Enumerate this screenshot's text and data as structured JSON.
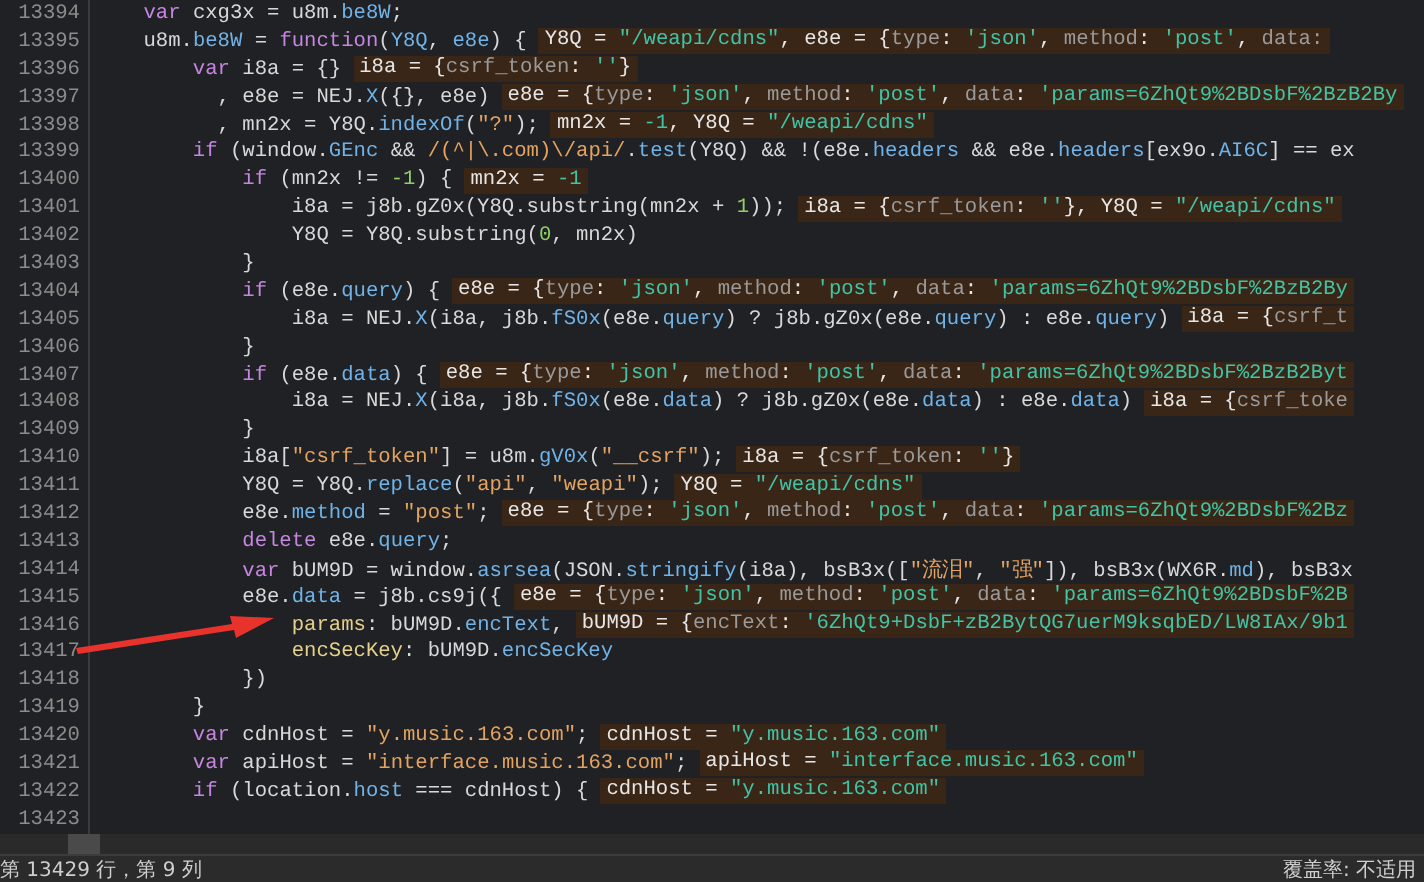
{
  "editor": {
    "lines": [
      {
        "number": "13394",
        "code": [
          {
            "kind": "keyword",
            "text": "    var"
          },
          {
            "kind": "plain",
            "text": " cxg3x = u8m."
          },
          {
            "kind": "property",
            "text": "be8W"
          },
          {
            "kind": "plain",
            "text": ";"
          }
        ]
      },
      {
        "number": "13395",
        "code": [
          {
            "kind": "plain",
            "text": "    u8m."
          },
          {
            "kind": "property",
            "text": "be8W"
          },
          {
            "kind": "plain",
            "text": " = "
          },
          {
            "kind": "keyword",
            "text": "function"
          },
          {
            "kind": "plain",
            "text": "("
          },
          {
            "kind": "property",
            "text": "Y8Q"
          },
          {
            "kind": "plain",
            "text": ", "
          },
          {
            "kind": "property",
            "text": "e8e"
          },
          {
            "kind": "plain",
            "text": ") {"
          }
        ],
        "values": [
          {
            "kind": "plain",
            "text": "Y8Q = "
          },
          {
            "kind": "str",
            "text": "\"/weapi/cdns\""
          },
          {
            "kind": "plain",
            "text": ", e8e = {"
          },
          {
            "kind": "key",
            "text": "type"
          },
          {
            "kind": "plain",
            "text": ": "
          },
          {
            "kind": "str",
            "text": "'json'"
          },
          {
            "kind": "plain",
            "text": ", "
          },
          {
            "kind": "key",
            "text": "method"
          },
          {
            "kind": "plain",
            "text": ": "
          },
          {
            "kind": "str",
            "text": "'post'"
          },
          {
            "kind": "plain",
            "text": ", "
          },
          {
            "kind": "key",
            "text": "data:"
          }
        ]
      },
      {
        "number": "13396",
        "code": [
          {
            "kind": "keyword",
            "text": "        var"
          },
          {
            "kind": "plain",
            "text": " i8a = {}"
          }
        ],
        "values": [
          {
            "kind": "plain",
            "text": "i8a = {"
          },
          {
            "kind": "key",
            "text": "csrf_token"
          },
          {
            "kind": "plain",
            "text": ": "
          },
          {
            "kind": "str",
            "text": "''"
          },
          {
            "kind": "plain",
            "text": "}"
          }
        ]
      },
      {
        "number": "13397",
        "code": [
          {
            "kind": "plain",
            "text": "          , e8e = NEJ."
          },
          {
            "kind": "property",
            "text": "X"
          },
          {
            "kind": "plain",
            "text": "({}, e8e)"
          }
        ],
        "values": [
          {
            "kind": "plain",
            "text": "e8e = {"
          },
          {
            "kind": "key",
            "text": "type"
          },
          {
            "kind": "plain",
            "text": ": "
          },
          {
            "kind": "str",
            "text": "'json'"
          },
          {
            "kind": "plain",
            "text": ", "
          },
          {
            "kind": "key",
            "text": "method"
          },
          {
            "kind": "plain",
            "text": ": "
          },
          {
            "kind": "str",
            "text": "'post'"
          },
          {
            "kind": "plain",
            "text": ", "
          },
          {
            "kind": "key",
            "text": "data"
          },
          {
            "kind": "plain",
            "text": ": "
          },
          {
            "kind": "str",
            "text": "'params=6ZhQt9%2BDsbF%2BzB2By"
          }
        ]
      },
      {
        "number": "13398",
        "code": [
          {
            "kind": "plain",
            "text": "          , mn2x = Y8Q."
          },
          {
            "kind": "property",
            "text": "indexOf"
          },
          {
            "kind": "plain",
            "text": "("
          },
          {
            "kind": "string",
            "text": "\"?\""
          },
          {
            "kind": "plain",
            "text": ");"
          }
        ],
        "values": [
          {
            "kind": "plain",
            "text": "mn2x = "
          },
          {
            "kind": "str",
            "text": "-1"
          },
          {
            "kind": "plain",
            "text": ", Y8Q = "
          },
          {
            "kind": "str",
            "text": "\"/weapi/cdns\""
          }
        ]
      },
      {
        "number": "13399",
        "code": [
          {
            "kind": "keyword",
            "text": "        if"
          },
          {
            "kind": "plain",
            "text": " (window."
          },
          {
            "kind": "property",
            "text": "GEnc"
          },
          {
            "kind": "plain",
            "text": " && "
          },
          {
            "kind": "string",
            "text": "/(^|\\.com)\\/api/"
          },
          {
            "kind": "plain",
            "text": "."
          },
          {
            "kind": "property",
            "text": "test"
          },
          {
            "kind": "plain",
            "text": "(Y8Q) && !(e8e."
          },
          {
            "kind": "property",
            "text": "headers"
          },
          {
            "kind": "plain",
            "text": " && e8e."
          },
          {
            "kind": "property",
            "text": "headers"
          },
          {
            "kind": "plain",
            "text": "[ex9o."
          },
          {
            "kind": "property",
            "text": "AI6C"
          },
          {
            "kind": "plain",
            "text": "] == ex"
          }
        ]
      },
      {
        "number": "13400",
        "code": [
          {
            "kind": "keyword",
            "text": "            if"
          },
          {
            "kind": "plain",
            "text": " (mn2x != "
          },
          {
            "kind": "number",
            "text": "-1"
          },
          {
            "kind": "plain",
            "text": ") {"
          }
        ],
        "values": [
          {
            "kind": "plain",
            "text": "mn2x = "
          },
          {
            "kind": "str",
            "text": "-1"
          }
        ]
      },
      {
        "number": "13401",
        "code": [
          {
            "kind": "plain",
            "text": "                i8a = j8b.gZ0x(Y8Q.substring(mn2x + "
          },
          {
            "kind": "number",
            "text": "1"
          },
          {
            "kind": "plain",
            "text": "));"
          }
        ],
        "values": [
          {
            "kind": "plain",
            "text": "i8a = {"
          },
          {
            "kind": "key",
            "text": "csrf_token"
          },
          {
            "kind": "plain",
            "text": ": "
          },
          {
            "kind": "str",
            "text": "''"
          },
          {
            "kind": "plain",
            "text": "}, Y8Q = "
          },
          {
            "kind": "str",
            "text": "\"/weapi/cdns\""
          }
        ]
      },
      {
        "number": "13402",
        "code": [
          {
            "kind": "plain",
            "text": "                Y8Q = Y8Q.substring("
          },
          {
            "kind": "number",
            "text": "0"
          },
          {
            "kind": "plain",
            "text": ", mn2x)"
          }
        ]
      },
      {
        "number": "13403",
        "code": [
          {
            "kind": "plain",
            "text": "            }"
          }
        ]
      },
      {
        "number": "13404",
        "code": [
          {
            "kind": "keyword",
            "text": "            if"
          },
          {
            "kind": "plain",
            "text": " (e8e."
          },
          {
            "kind": "property",
            "text": "query"
          },
          {
            "kind": "plain",
            "text": ") {"
          }
        ],
        "values": [
          {
            "kind": "plain",
            "text": "e8e = {"
          },
          {
            "kind": "key",
            "text": "type"
          },
          {
            "kind": "plain",
            "text": ": "
          },
          {
            "kind": "str",
            "text": "'json'"
          },
          {
            "kind": "plain",
            "text": ", "
          },
          {
            "kind": "key",
            "text": "method"
          },
          {
            "kind": "plain",
            "text": ": "
          },
          {
            "kind": "str",
            "text": "'post'"
          },
          {
            "kind": "plain",
            "text": ", "
          },
          {
            "kind": "key",
            "text": "data"
          },
          {
            "kind": "plain",
            "text": ": "
          },
          {
            "kind": "str",
            "text": "'params=6ZhQt9%2BDsbF%2BzB2By"
          }
        ]
      },
      {
        "number": "13405",
        "code": [
          {
            "kind": "plain",
            "text": "                i8a = NEJ."
          },
          {
            "kind": "property",
            "text": "X"
          },
          {
            "kind": "plain",
            "text": "(i8a, j8b."
          },
          {
            "kind": "property",
            "text": "fS0x"
          },
          {
            "kind": "plain",
            "text": "(e8e."
          },
          {
            "kind": "property",
            "text": "query"
          },
          {
            "kind": "plain",
            "text": ") ? j8b.gZ0x(e8e."
          },
          {
            "kind": "property",
            "text": "query"
          },
          {
            "kind": "plain",
            "text": ") : e8e."
          },
          {
            "kind": "property",
            "text": "query"
          },
          {
            "kind": "plain",
            "text": ")"
          }
        ],
        "values": [
          {
            "kind": "plain",
            "text": "i8a = {"
          },
          {
            "kind": "key",
            "text": "csrf_t"
          }
        ]
      },
      {
        "number": "13406",
        "code": [
          {
            "kind": "plain",
            "text": "            }"
          }
        ]
      },
      {
        "number": "13407",
        "code": [
          {
            "kind": "keyword",
            "text": "            if"
          },
          {
            "kind": "plain",
            "text": " (e8e."
          },
          {
            "kind": "property",
            "text": "data"
          },
          {
            "kind": "plain",
            "text": ") {"
          }
        ],
        "values": [
          {
            "kind": "plain",
            "text": "e8e = {"
          },
          {
            "kind": "key",
            "text": "type"
          },
          {
            "kind": "plain",
            "text": ": "
          },
          {
            "kind": "str",
            "text": "'json'"
          },
          {
            "kind": "plain",
            "text": ", "
          },
          {
            "kind": "key",
            "text": "method"
          },
          {
            "kind": "plain",
            "text": ": "
          },
          {
            "kind": "str",
            "text": "'post'"
          },
          {
            "kind": "plain",
            "text": ", "
          },
          {
            "kind": "key",
            "text": "data"
          },
          {
            "kind": "plain",
            "text": ": "
          },
          {
            "kind": "str",
            "text": "'params=6ZhQt9%2BDsbF%2BzB2Byt"
          }
        ]
      },
      {
        "number": "13408",
        "code": [
          {
            "kind": "plain",
            "text": "                i8a = NEJ."
          },
          {
            "kind": "property",
            "text": "X"
          },
          {
            "kind": "plain",
            "text": "(i8a, j8b."
          },
          {
            "kind": "property",
            "text": "fS0x"
          },
          {
            "kind": "plain",
            "text": "(e8e."
          },
          {
            "kind": "property",
            "text": "data"
          },
          {
            "kind": "plain",
            "text": ") ? j8b.gZ0x(e8e."
          },
          {
            "kind": "property",
            "text": "data"
          },
          {
            "kind": "plain",
            "text": ") : e8e."
          },
          {
            "kind": "property",
            "text": "data"
          },
          {
            "kind": "plain",
            "text": ")"
          }
        ],
        "values": [
          {
            "kind": "plain",
            "text": "i8a = {"
          },
          {
            "kind": "key",
            "text": "csrf_toke"
          }
        ]
      },
      {
        "number": "13409",
        "code": [
          {
            "kind": "plain",
            "text": "            }"
          }
        ]
      },
      {
        "number": "13410",
        "code": [
          {
            "kind": "plain",
            "text": "            i8a["
          },
          {
            "kind": "string",
            "text": "\"csrf_token\""
          },
          {
            "kind": "plain",
            "text": "] = u8m."
          },
          {
            "kind": "property",
            "text": "gV0x"
          },
          {
            "kind": "plain",
            "text": "("
          },
          {
            "kind": "string",
            "text": "\"__csrf\""
          },
          {
            "kind": "plain",
            "text": ");"
          }
        ],
        "values": [
          {
            "kind": "plain",
            "text": "i8a = {"
          },
          {
            "kind": "key",
            "text": "csrf_token"
          },
          {
            "kind": "plain",
            "text": ": "
          },
          {
            "kind": "str",
            "text": "''"
          },
          {
            "kind": "plain",
            "text": "}"
          }
        ]
      },
      {
        "number": "13411",
        "code": [
          {
            "kind": "plain",
            "text": "            Y8Q = Y8Q."
          },
          {
            "kind": "property",
            "text": "replace"
          },
          {
            "kind": "plain",
            "text": "("
          },
          {
            "kind": "string",
            "text": "\"api\""
          },
          {
            "kind": "plain",
            "text": ", "
          },
          {
            "kind": "string",
            "text": "\"weapi\""
          },
          {
            "kind": "plain",
            "text": ");"
          }
        ],
        "values": [
          {
            "kind": "plain",
            "text": "Y8Q = "
          },
          {
            "kind": "str",
            "text": "\"/weapi/cdns\""
          }
        ]
      },
      {
        "number": "13412",
        "code": [
          {
            "kind": "plain",
            "text": "            e8e."
          },
          {
            "kind": "property",
            "text": "method"
          },
          {
            "kind": "plain",
            "text": " = "
          },
          {
            "kind": "string",
            "text": "\"post\""
          },
          {
            "kind": "plain",
            "text": ";"
          }
        ],
        "values": [
          {
            "kind": "plain",
            "text": "e8e = {"
          },
          {
            "kind": "key",
            "text": "type"
          },
          {
            "kind": "plain",
            "text": ": "
          },
          {
            "kind": "str",
            "text": "'json'"
          },
          {
            "kind": "plain",
            "text": ", "
          },
          {
            "kind": "key",
            "text": "method"
          },
          {
            "kind": "plain",
            "text": ": "
          },
          {
            "kind": "str",
            "text": "'post'"
          },
          {
            "kind": "plain",
            "text": ", "
          },
          {
            "kind": "key",
            "text": "data"
          },
          {
            "kind": "plain",
            "text": ": "
          },
          {
            "kind": "str",
            "text": "'params=6ZhQt9%2BDsbF%2Bz"
          }
        ]
      },
      {
        "number": "13413",
        "code": [
          {
            "kind": "keyword",
            "text": "            delete"
          },
          {
            "kind": "plain",
            "text": " e8e."
          },
          {
            "kind": "property",
            "text": "query"
          },
          {
            "kind": "plain",
            "text": ";"
          }
        ]
      },
      {
        "number": "13414",
        "code": [
          {
            "kind": "keyword",
            "text": "            var"
          },
          {
            "kind": "plain",
            "text": " bUM9D = window."
          },
          {
            "kind": "property",
            "text": "asrsea"
          },
          {
            "kind": "plain",
            "text": "(JSON."
          },
          {
            "kind": "property",
            "text": "stringify"
          },
          {
            "kind": "plain",
            "text": "(i8a), bsB3x(["
          },
          {
            "kind": "string",
            "text": "\"流泪\""
          },
          {
            "kind": "plain",
            "text": ", "
          },
          {
            "kind": "string",
            "text": "\"强\""
          },
          {
            "kind": "plain",
            "text": "]), bsB3x(WX6R."
          },
          {
            "kind": "property",
            "text": "md"
          },
          {
            "kind": "plain",
            "text": "), bsB3x"
          }
        ]
      },
      {
        "number": "13415",
        "code": [
          {
            "kind": "plain",
            "text": "            e8e."
          },
          {
            "kind": "property",
            "text": "data"
          },
          {
            "kind": "plain",
            "text": " = j8b.cs9j({"
          }
        ],
        "values": [
          {
            "kind": "plain",
            "text": "e8e = {"
          },
          {
            "kind": "key",
            "text": "type"
          },
          {
            "kind": "plain",
            "text": ": "
          },
          {
            "kind": "str",
            "text": "'json'"
          },
          {
            "kind": "plain",
            "text": ", "
          },
          {
            "kind": "key",
            "text": "method"
          },
          {
            "kind": "plain",
            "text": ": "
          },
          {
            "kind": "str",
            "text": "'post'"
          },
          {
            "kind": "plain",
            "text": ", "
          },
          {
            "kind": "key",
            "text": "data"
          },
          {
            "kind": "plain",
            "text": ": "
          },
          {
            "kind": "str",
            "text": "'params=6ZhQt9%2BDsbF%2B"
          }
        ]
      },
      {
        "number": "13416",
        "code": [
          {
            "kind": "label",
            "text": "                params"
          },
          {
            "kind": "plain",
            "text": ": bUM9D."
          },
          {
            "kind": "property",
            "text": "encText"
          },
          {
            "kind": "plain",
            "text": ","
          }
        ],
        "values": [
          {
            "kind": "plain",
            "text": "bUM9D = {"
          },
          {
            "kind": "key",
            "text": "encText"
          },
          {
            "kind": "plain",
            "text": ": "
          },
          {
            "kind": "str",
            "text": "'6ZhQt9+DsbF+zB2BytQG7uerM9ksqbED/LW8IAx/9b1"
          }
        ]
      },
      {
        "number": "13417",
        "code": [
          {
            "kind": "label",
            "text": "                encSecKey"
          },
          {
            "kind": "plain",
            "text": ": bUM9D."
          },
          {
            "kind": "property",
            "text": "encSecKey"
          }
        ]
      },
      {
        "number": "13418",
        "code": [
          {
            "kind": "plain",
            "text": "            })"
          }
        ]
      },
      {
        "number": "13419",
        "code": [
          {
            "kind": "plain",
            "text": "        }"
          }
        ]
      },
      {
        "number": "13420",
        "code": [
          {
            "kind": "keyword",
            "text": "        var"
          },
          {
            "kind": "plain",
            "text": " cdnHost = "
          },
          {
            "kind": "string",
            "text": "\"y.music.163.com\""
          },
          {
            "kind": "plain",
            "text": ";"
          }
        ],
        "values": [
          {
            "kind": "plain",
            "text": "cdnHost = "
          },
          {
            "kind": "str",
            "text": "\"y.music.163.com\""
          }
        ]
      },
      {
        "number": "13421",
        "code": [
          {
            "kind": "keyword",
            "text": "        var"
          },
          {
            "kind": "plain",
            "text": " apiHost = "
          },
          {
            "kind": "string",
            "text": "\"interface.music.163.com\""
          },
          {
            "kind": "plain",
            "text": ";"
          }
        ],
        "values": [
          {
            "kind": "plain",
            "text": "apiHost = "
          },
          {
            "kind": "str",
            "text": "\"interface.music.163.com\""
          }
        ]
      },
      {
        "number": "13422",
        "code": [
          {
            "kind": "keyword",
            "text": "        if"
          },
          {
            "kind": "plain",
            "text": " (location."
          },
          {
            "kind": "property",
            "text": "host"
          },
          {
            "kind": "plain",
            "text": " === cdnHost) {"
          }
        ],
        "values": [
          {
            "kind": "plain",
            "text": "cdnHost = "
          },
          {
            "kind": "str",
            "text": "\"y.music.163.com\""
          }
        ]
      },
      {
        "number": "13423"
      }
    ]
  },
  "status_bar": {
    "position": "第 13429 行，第 9 列",
    "coverage": "覆盖率: 不适用"
  }
}
